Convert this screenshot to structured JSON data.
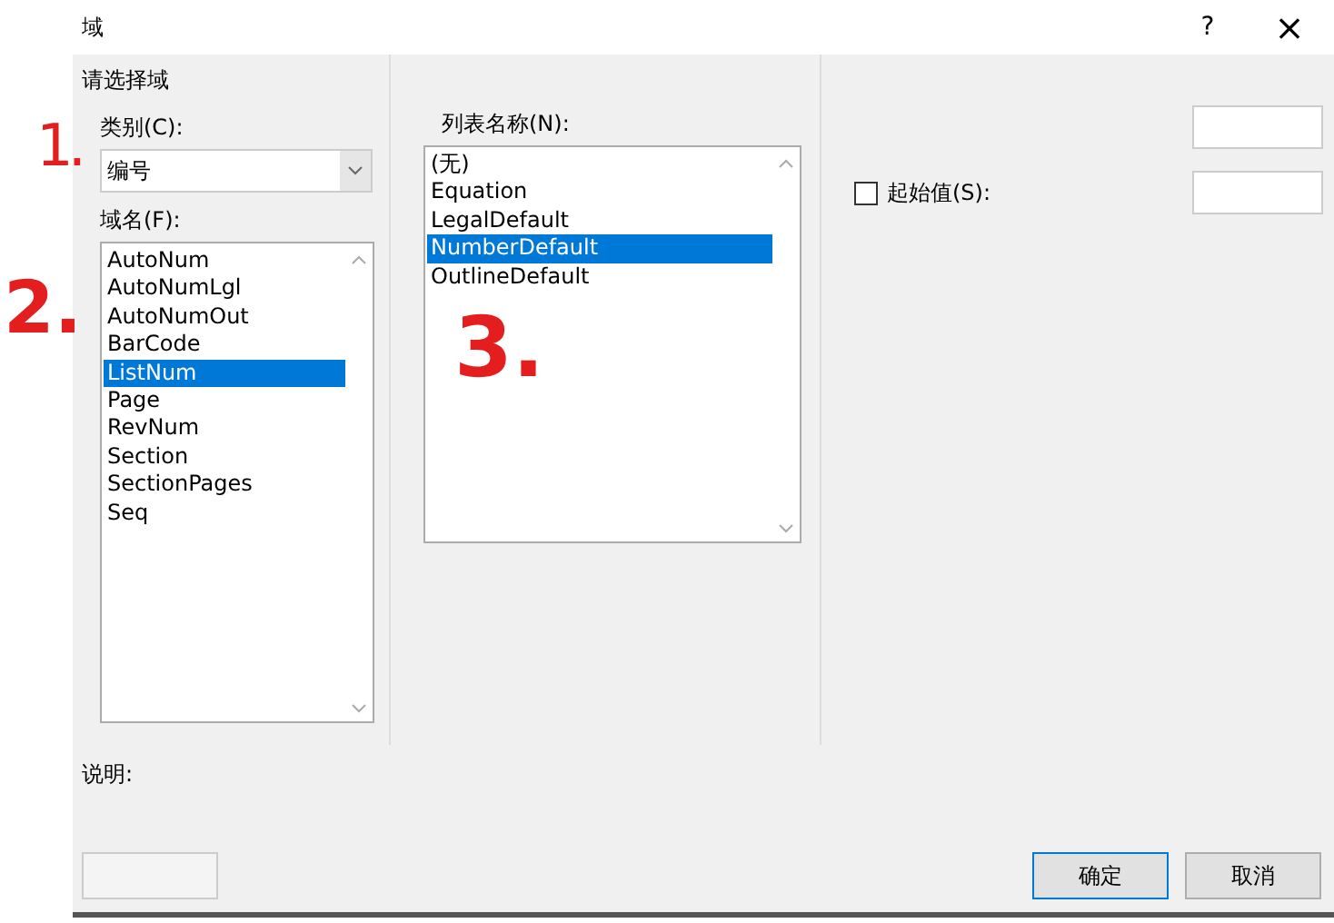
{
  "window": {
    "title": "域",
    "help": "?",
    "close": "×"
  },
  "group_title": "请选择域",
  "category": {
    "label": "类别(C):",
    "value": "编号"
  },
  "field_names": {
    "label": "域名(F):",
    "items": [
      {
        "label": "AutoNum",
        "selected": false
      },
      {
        "label": "AutoNumLgl",
        "selected": false
      },
      {
        "label": "AutoNumOut",
        "selected": false
      },
      {
        "label": "BarCode",
        "selected": false
      },
      {
        "label": "ListNum",
        "selected": true
      },
      {
        "label": "Page",
        "selected": false
      },
      {
        "label": "RevNum",
        "selected": false
      },
      {
        "label": "Section",
        "selected": false
      },
      {
        "label": "SectionPages",
        "selected": false
      },
      {
        "label": "Seq",
        "selected": false
      }
    ]
  },
  "list_names": {
    "label": "列表名称(N):",
    "items": [
      {
        "label": "(无)",
        "selected": false
      },
      {
        "label": "Equation",
        "selected": false
      },
      {
        "label": "LegalDefault",
        "selected": false
      },
      {
        "label": "NumberDefault",
        "selected": true
      },
      {
        "label": "OutlineDefault",
        "selected": false
      }
    ]
  },
  "start_value": {
    "label": "起始值(S):",
    "checked": false
  },
  "description_label": "说明:",
  "buttons": [
    {
      "label": "确定",
      "default": true
    },
    {
      "label": "取消",
      "default": false
    }
  ],
  "annotations": [
    "1.",
    "2.",
    "3."
  ]
}
